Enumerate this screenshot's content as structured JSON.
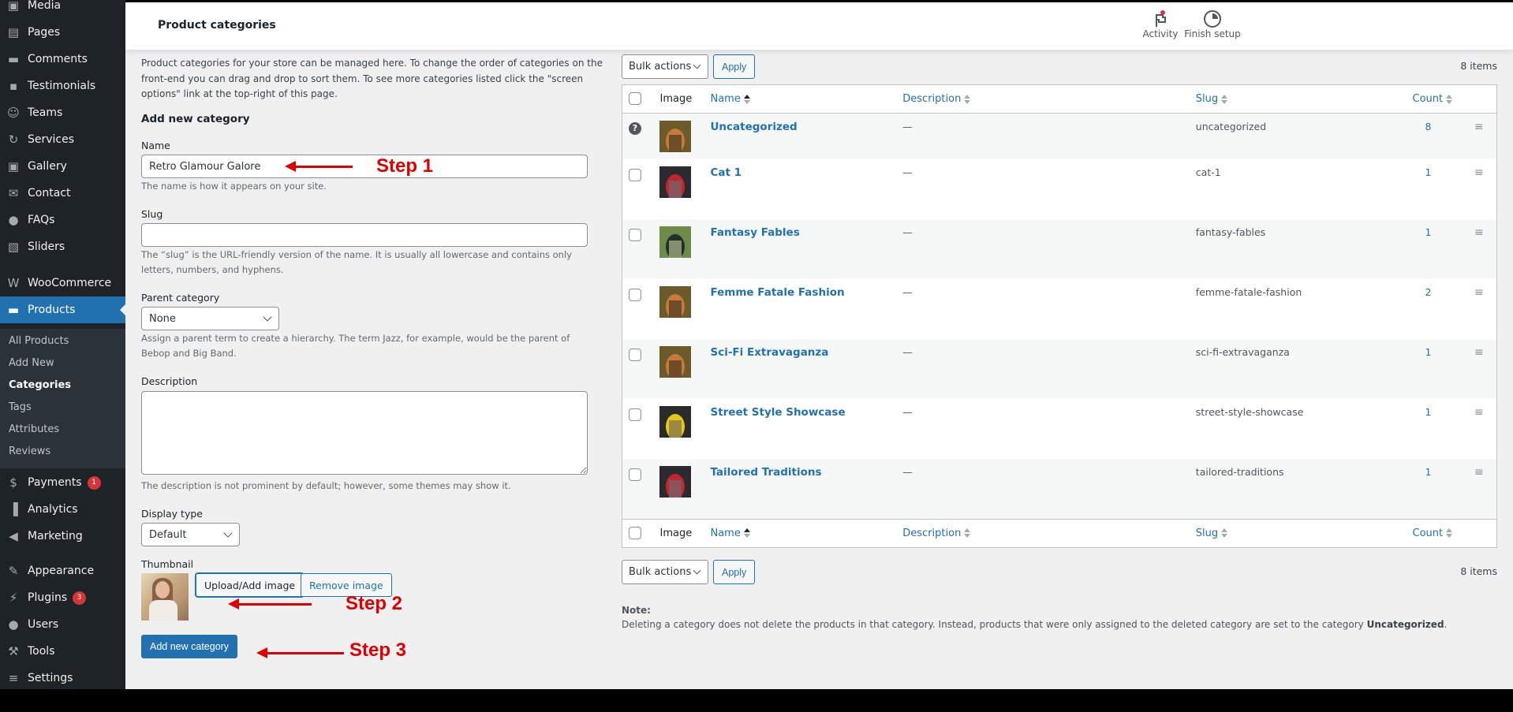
{
  "sidebar": {
    "items": [
      {
        "label": "Media",
        "icon": "media-icon"
      },
      {
        "label": "Pages",
        "icon": "pages-icon"
      },
      {
        "label": "Comments",
        "icon": "comments-icon"
      },
      {
        "label": "Testimonials",
        "icon": "testimonials-icon"
      },
      {
        "label": "Teams",
        "icon": "teams-icon"
      },
      {
        "label": "Services",
        "icon": "services-icon"
      },
      {
        "label": "Gallery",
        "icon": "gallery-icon"
      },
      {
        "label": "Contact",
        "icon": "envelope-icon"
      },
      {
        "label": "FAQs",
        "icon": "speech-bubble-icon"
      },
      {
        "label": "Sliders",
        "icon": "sliders-icon"
      },
      {
        "label": "WooCommerce",
        "icon": "woocommerce-icon"
      },
      {
        "label": "Products",
        "icon": "archive-box-icon",
        "active": true
      },
      {
        "label": "Payments",
        "icon": "dollar-icon",
        "badge": "1"
      },
      {
        "label": "Analytics",
        "icon": "bar-chart-icon"
      },
      {
        "label": "Marketing",
        "icon": "megaphone-icon"
      },
      {
        "label": "Appearance",
        "icon": "paintbrush-icon"
      },
      {
        "label": "Plugins",
        "icon": "plug-icon",
        "badge": "3"
      },
      {
        "label": "Users",
        "icon": "user-icon"
      },
      {
        "label": "Tools",
        "icon": "wrench-icon"
      },
      {
        "label": "Settings",
        "icon": "settings-icon"
      }
    ],
    "submenu": [
      {
        "label": "All Products"
      },
      {
        "label": "Add New"
      },
      {
        "label": "Categories",
        "current": true
      },
      {
        "label": "Tags"
      },
      {
        "label": "Attributes"
      },
      {
        "label": "Reviews"
      }
    ]
  },
  "header": {
    "title": "Product categories",
    "activity_label": "Activity",
    "finish_setup_label": "Finish setup"
  },
  "form": {
    "intro": "Product categories for your store can be managed here. To change the order of categories on the front-end you can drag and drop to sort them. To see more categories listed click the \"screen options\" link at the top-right of this page.",
    "heading": "Add new category",
    "name_label": "Name",
    "name_value": "Retro Glamour Galore",
    "name_help": "The name is how it appears on your site.",
    "slug_label": "Slug",
    "slug_value": "",
    "slug_help": "The “slug” is the URL-friendly version of the name. It is usually all lowercase and contains only letters, numbers, and hyphens.",
    "parent_label": "Parent category",
    "parent_value": "None",
    "parent_help": "Assign a parent term to create a hierarchy. The term Jazz, for example, would be the parent of Bebop and Big Band.",
    "description_label": "Description",
    "description_value": "",
    "description_help": "The description is not prominent by default; however, some themes may show it.",
    "display_type_label": "Display type",
    "display_type_value": "Default",
    "thumbnail_label": "Thumbnail",
    "upload_button": "Upload/Add image",
    "remove_button": "Remove image",
    "submit_button": "Add new category"
  },
  "annotations": {
    "step1": "Step 1",
    "step2": "Step 2",
    "step3": "Step 3",
    "color": "#e00000"
  },
  "table": {
    "bulk_actions": "Bulk actions",
    "apply": "Apply",
    "items_count": "8 items",
    "columns": {
      "image": "Image",
      "name": "Name",
      "description": "Description",
      "slug": "Slug",
      "count": "Count"
    },
    "rows": [
      {
        "name": "Uncategorized",
        "description": "—",
        "slug": "uncategorized",
        "count": "8",
        "default": true,
        "thumb": [
          "#6b5a2a",
          "#c77a3a",
          "#4a3b22"
        ]
      },
      {
        "name": "Cat 1",
        "description": "—",
        "slug": "cat-1",
        "count": "1",
        "thumb": [
          "#2a2a30",
          "#c2262b",
          "#6e6870"
        ]
      },
      {
        "name": "Fantasy Fables",
        "description": "—",
        "slug": "fantasy-fables",
        "count": "1",
        "thumb": [
          "#6f8b4a",
          "#24302a",
          "#a8b98a"
        ]
      },
      {
        "name": "Femme Fatale Fashion",
        "description": "—",
        "slug": "femme-fatale-fashion",
        "count": "2",
        "thumb": [
          "#6b5a2a",
          "#c77a3a",
          "#4a3b22"
        ]
      },
      {
        "name": "Sci-Fi Extravaganza",
        "description": "—",
        "slug": "sci-fi-extravaganza",
        "count": "1",
        "thumb": [
          "#6b5a2a",
          "#c77a3a",
          "#4a3b22"
        ]
      },
      {
        "name": "Street Style Showcase",
        "description": "—",
        "slug": "street-style-showcase",
        "count": "1",
        "thumb": [
          "#2b2b2b",
          "#e6c619",
          "#7a6d55"
        ]
      },
      {
        "name": "Tailored Traditions",
        "description": "—",
        "slug": "tailored-traditions",
        "count": "1",
        "thumb": [
          "#2a2a30",
          "#c2262b",
          "#6e6870"
        ]
      }
    ]
  },
  "note": {
    "heading": "Note:",
    "text": "Deleting a category does not delete the products in that category. Instead, products that were only assigned to the deleted category are set to the category ",
    "bold": "Uncategorized",
    "end": "."
  },
  "colors": {
    "accent": "#2271b1",
    "sidebar_bg": "#1d2327",
    "badge": "#d63638"
  }
}
